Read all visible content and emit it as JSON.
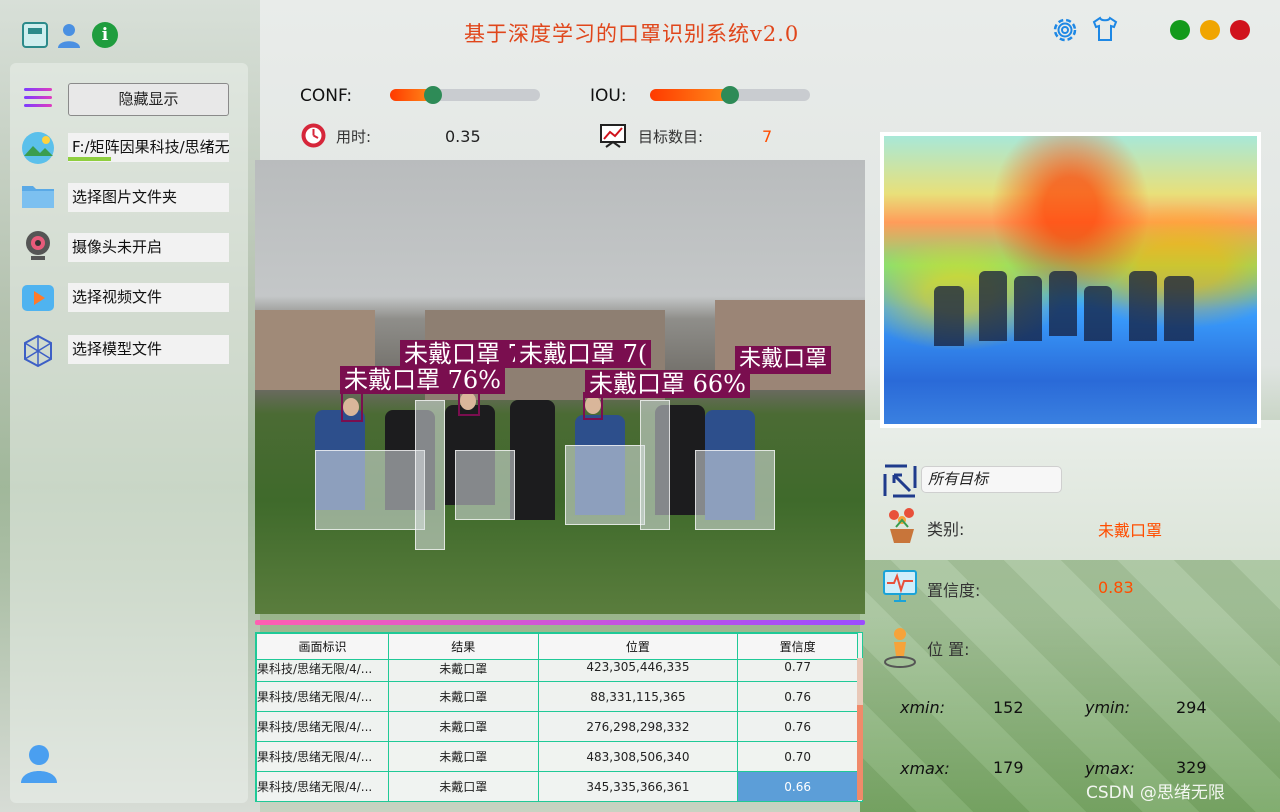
{
  "app": {
    "title": "基于深度学习的口罩识别系统v2.0"
  },
  "sidebar": {
    "toggle_label": "隐藏显示",
    "image_path": "F:/矩阵因果科技/思绪无限",
    "folder_label": "选择图片文件夹",
    "camera_label": "摄像头未开启",
    "video_label": "选择视频文件",
    "model_label": "选择模型文件"
  },
  "controls": {
    "conf_label": "CONF:",
    "conf_value": 0.25,
    "iou_label": "IOU:",
    "iou_value": 0.5,
    "time_label": "用时:",
    "time_value": "0.35",
    "count_label": "目标数目:",
    "count_value": "7"
  },
  "detections": [
    {
      "label": "未戴口罩",
      "text": "未戴口罩 76%"
    },
    {
      "label": "未戴口罩",
      "text": "未戴口罩 66%"
    },
    {
      "label": "未戴口罩",
      "text": "未戴口罩 7("
    },
    {
      "label": "未戴口罩",
      "text": "未戴口罩 7("
    },
    {
      "label": "未戴口罩",
      "text": "未戴口罩"
    }
  ],
  "table": {
    "headers": [
      "画面标识",
      "结果",
      "位置",
      "置信度"
    ],
    "rows": [
      {
        "source": "果科技/思绪无限/4/...",
        "result": "未戴口罩",
        "position": "423,305,446,335",
        "conf": "0.77"
      },
      {
        "source": "果科技/思绪无限/4/...",
        "result": "未戴口罩",
        "position": "88,331,115,365",
        "conf": "0.76"
      },
      {
        "source": "果科技/思绪无限/4/...",
        "result": "未戴口罩",
        "position": "276,298,298,332",
        "conf": "0.76"
      },
      {
        "source": "果科技/思绪无限/4/...",
        "result": "未戴口罩",
        "position": "483,308,506,340",
        "conf": "0.70"
      },
      {
        "source": "果科技/思绪无限/4/...",
        "result": "未戴口罩",
        "position": "345,335,366,361",
        "conf": "0.66"
      }
    ]
  },
  "detail": {
    "target_select": "所有目标",
    "class_label": "类别:",
    "class_value": "未戴口罩",
    "conf_label": "置信度:",
    "conf_value": "0.83",
    "pos_label": "位 置:",
    "xmin_label": "xmin:",
    "xmin_value": "152",
    "ymin_label": "ymin:",
    "ymin_value": "294",
    "xmax_label": "xmax:",
    "xmax_value": "179",
    "ymax_label": "ymax:",
    "ymax_value": "329"
  },
  "watermark": "CSDN @思绪无限",
  "colors": {
    "title": "#e0461b",
    "accent": "#ff4d00",
    "table_border": "#20c997",
    "box": "#7a0e4f"
  }
}
